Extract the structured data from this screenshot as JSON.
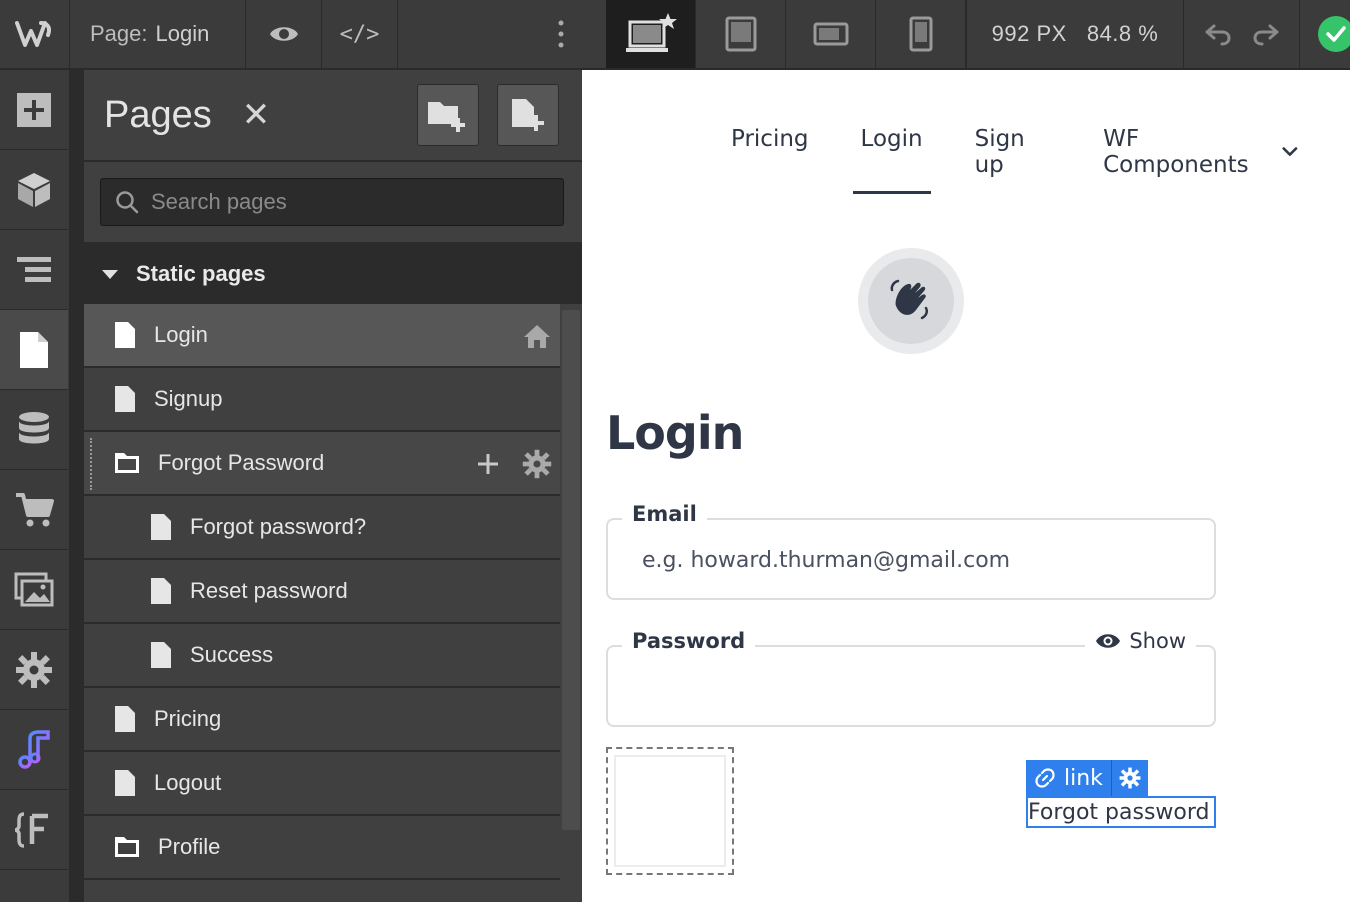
{
  "topbar": {
    "page_prefix": "Page:",
    "page_name": "Login",
    "code_label": "</>",
    "width_px": "992 PX",
    "zoom": "84.8 %"
  },
  "pages_panel": {
    "title": "Pages",
    "close": "✕",
    "search_placeholder": "Search pages",
    "section_title": "Static pages",
    "rows": [
      {
        "label": "Login"
      },
      {
        "label": "Signup"
      },
      {
        "label": "Forgot Password"
      },
      {
        "label": "Forgot password?"
      },
      {
        "label": "Reset password"
      },
      {
        "label": "Success"
      },
      {
        "label": "Pricing"
      },
      {
        "label": "Logout"
      },
      {
        "label": "Profile"
      }
    ]
  },
  "canvas": {
    "nav": [
      "Pricing",
      "Login",
      "Sign up",
      "WF Components"
    ],
    "heading": "Login",
    "email_label": "Email",
    "email_placeholder": "e.g. howard.thurman@gmail.com",
    "password_label": "Password",
    "show_label": "Show",
    "badge_label": "link",
    "forgot_link": "Forgot password"
  },
  "colors": {
    "accent": "#2f80ed",
    "success": "#35c46a",
    "text_dark": "#2f3747"
  }
}
